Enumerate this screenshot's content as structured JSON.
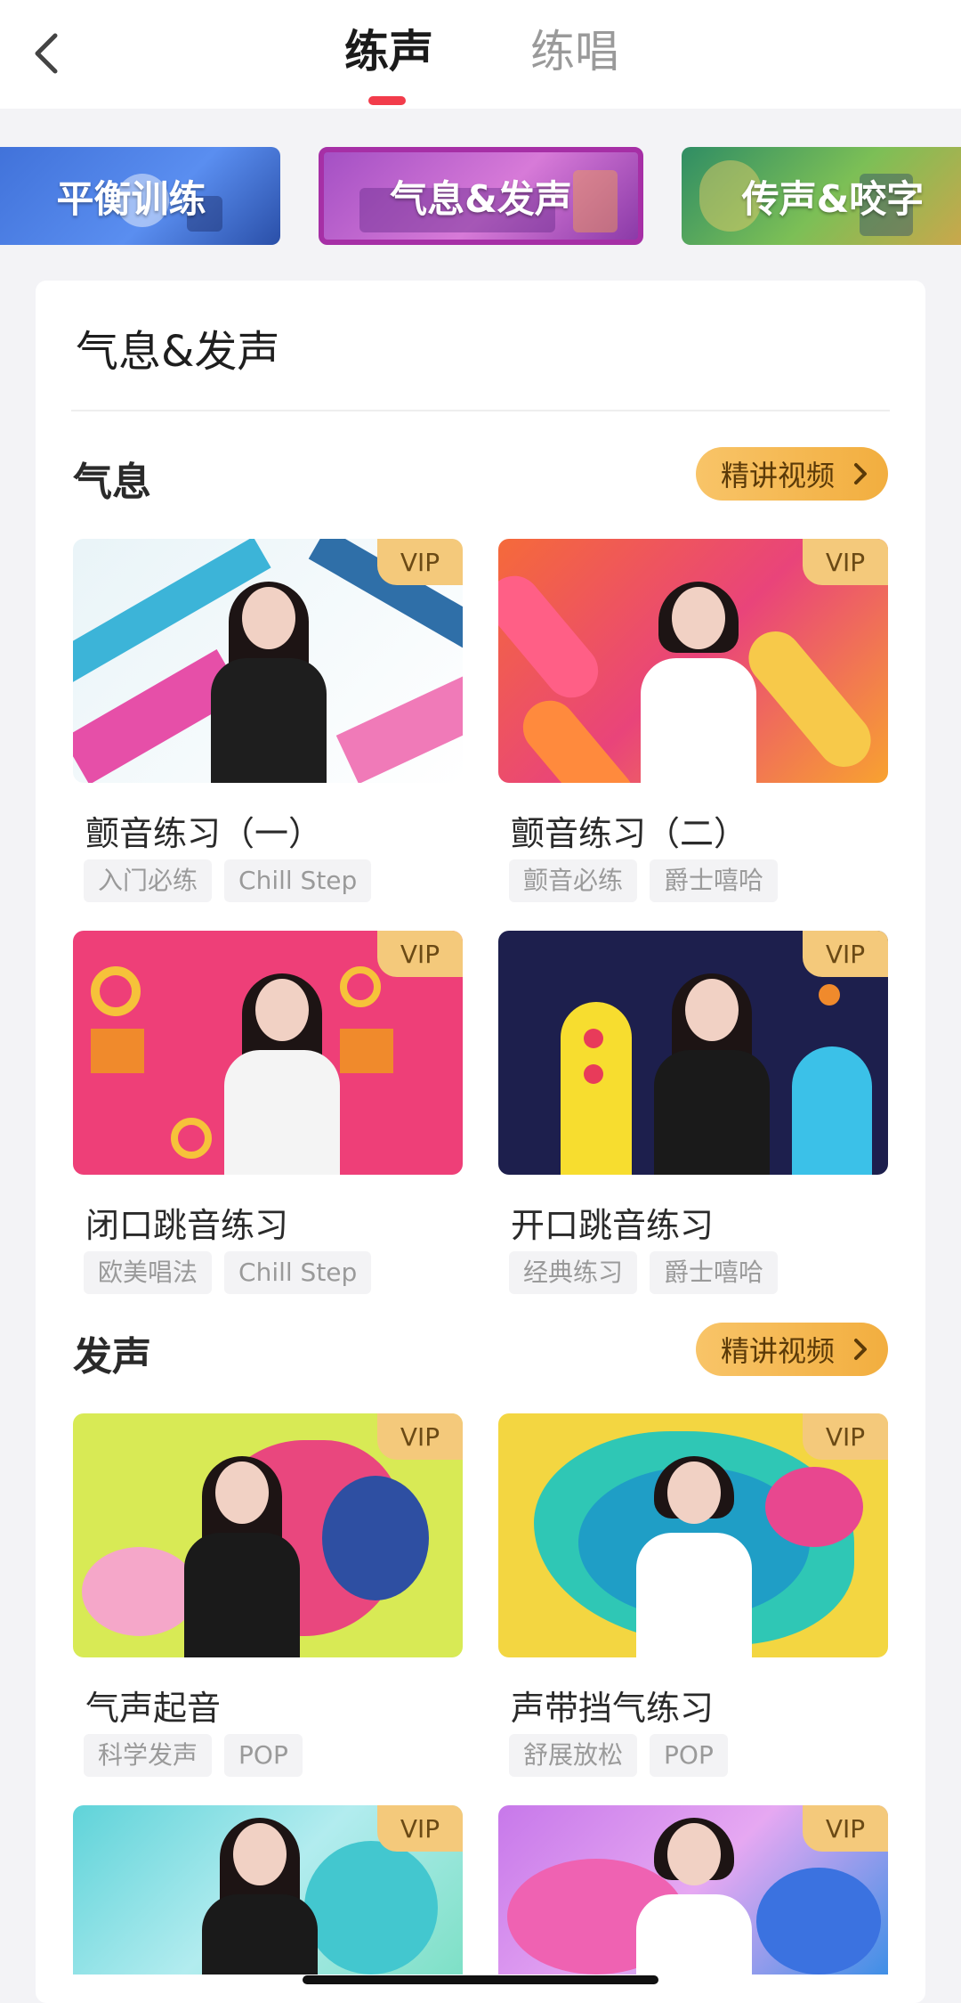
{
  "header": {
    "tabs": [
      {
        "label": "练声",
        "active": true
      },
      {
        "label": "练唱",
        "active": false
      }
    ],
    "accent_color": "#f23c4b"
  },
  "categories": [
    {
      "label": "平衡训练"
    },
    {
      "label": "气息&发声",
      "selected": true
    },
    {
      "label": "传声&咬字"
    }
  ],
  "card": {
    "title": "气息&发声",
    "sections": [
      {
        "title": "气息",
        "button_label": "精讲视频",
        "items": [
          {
            "title": "颤音练习（一）",
            "badge": "VIP",
            "tags": [
              "入门必练",
              "Chill Step"
            ]
          },
          {
            "title": "颤音练习（二）",
            "badge": "VIP",
            "tags": [
              "颤音必练",
              "爵士嘻哈"
            ]
          },
          {
            "title": "闭口跳音练习",
            "badge": "VIP",
            "tags": [
              "欧美唱法",
              "Chill Step"
            ]
          },
          {
            "title": "开口跳音练习",
            "badge": "VIP",
            "tags": [
              "经典练习",
              "爵士嘻哈"
            ]
          }
        ]
      },
      {
        "title": "发声",
        "button_label": "精讲视频",
        "items": [
          {
            "title": "气声起音",
            "badge": "VIP",
            "tags": [
              "科学发声",
              "POP"
            ]
          },
          {
            "title": "声带挡气练习",
            "badge": "VIP",
            "tags": [
              "舒展放松",
              "POP"
            ]
          },
          {
            "title": "",
            "badge": "VIP",
            "tags": []
          },
          {
            "title": "",
            "badge": "VIP",
            "tags": []
          }
        ]
      }
    ]
  },
  "icons": {
    "back": "chevron-left-icon",
    "pill_arrow": "chevron-right-icon"
  }
}
